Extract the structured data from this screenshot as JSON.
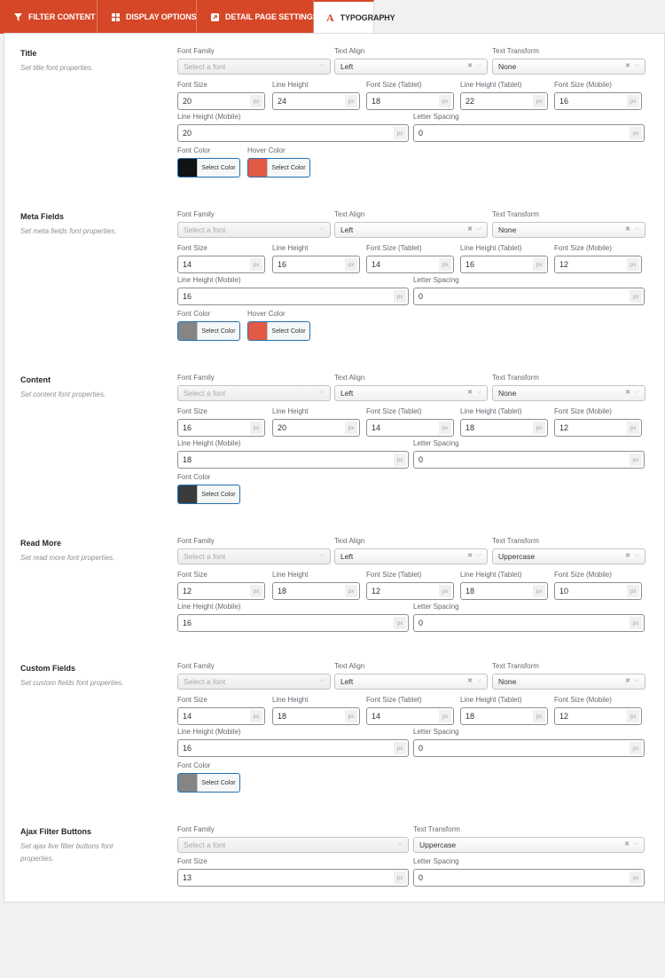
{
  "tabs": [
    {
      "label": "FILTER CONTENT",
      "icon": "filter-icon",
      "active": false
    },
    {
      "label": "DISPLAY OPTIONS",
      "icon": "grid-icon",
      "active": false
    },
    {
      "label": "DETAIL PAGE SETTINGS",
      "icon": "external-page-icon",
      "active": false
    },
    {
      "label": "TYPOGRAPHY",
      "icon": "typography-icon",
      "active": true
    }
  ],
  "labels": {
    "font_family": "Font Family",
    "text_align": "Text Align",
    "text_transform": "Text Transform",
    "font_size": "Font Size",
    "line_height": "Line Height",
    "font_size_tablet": "Font Size (Tablet)",
    "line_height_tablet": "Line Height (Tablet)",
    "font_size_mobile": "Font Size (Mobile)",
    "line_height_mobile": "Line Height (Mobile)",
    "letter_spacing": "Letter Spacing",
    "font_color": "Font Color",
    "hover_color": "Hover Color",
    "select_color": "Select Color",
    "unit": "px",
    "font_placeholder": "Select a font"
  },
  "sections": [
    {
      "title": "Title",
      "desc": "Set title font properties.",
      "font_family": "",
      "text_align": "Left",
      "text_transform": "None",
      "font_size": "20",
      "line_height": "24",
      "font_size_tablet": "18",
      "line_height_tablet": "22",
      "font_size_mobile": "16",
      "line_height_mobile": "20",
      "letter_spacing": "0",
      "font_color": "#101214",
      "hover_color": "#e05a45"
    },
    {
      "title": "Meta Fields",
      "desc": "Set meta fields font properties.",
      "font_family": "",
      "text_align": "Left",
      "text_transform": "None",
      "font_size": "14",
      "line_height": "16",
      "font_size_tablet": "14",
      "line_height_tablet": "16",
      "font_size_mobile": "12",
      "line_height_mobile": "16",
      "letter_spacing": "0",
      "font_color": "#858585",
      "hover_color": "#e05a45"
    },
    {
      "title": "Content",
      "desc": "Set content font properties.",
      "font_family": "",
      "text_align": "Left",
      "text_transform": "None",
      "font_size": "16",
      "line_height": "20",
      "font_size_tablet": "14",
      "line_height_tablet": "18",
      "font_size_mobile": "12",
      "line_height_mobile": "18",
      "letter_spacing": "0",
      "font_color": "#3a3b3d"
    },
    {
      "title": "Read More",
      "desc": "Set read more font properties.",
      "font_family": "",
      "text_align": "Left",
      "text_transform": "Uppercase",
      "font_size": "12",
      "line_height": "18",
      "font_size_tablet": "12",
      "line_height_tablet": "18",
      "font_size_mobile": "10",
      "line_height_mobile": "16",
      "letter_spacing": "0"
    },
    {
      "title": "Custom Fields",
      "desc": "Set custom fields font properties.",
      "font_family": "",
      "text_align": "Left",
      "text_transform": "None",
      "font_size": "14",
      "line_height": "18",
      "font_size_tablet": "14",
      "line_height_tablet": "18",
      "font_size_mobile": "12",
      "line_height_mobile": "16",
      "letter_spacing": "0",
      "font_color": "#858585"
    },
    {
      "title": "Ajax Filter Buttons",
      "desc": "Set ajax live filter buttons font properties.",
      "font_family": "",
      "text_transform": "Uppercase",
      "font_size": "13",
      "letter_spacing": "0"
    }
  ]
}
